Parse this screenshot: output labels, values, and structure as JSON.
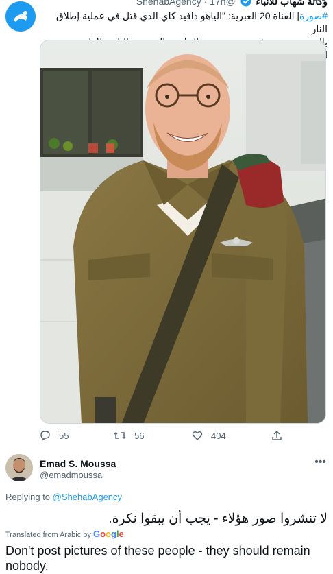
{
  "source_tweet": {
    "display_name": "وكالة شهاب للأنباء",
    "handle": "@ShehabAgency",
    "time": "· 17h",
    "hashtag": "#صورة",
    "text_line1": "| القناة 20 العبرية: \"الياهو دافيد كاي الذي قتل في عملية إطلاق النار",
    "text_line2": "بالقدس، ويخدم في سرية حيتس الخاصة بالحريديم التابعة للواء المظليين\"."
  },
  "actions": {
    "replies": "55",
    "retweets": "56",
    "likes": "404"
  },
  "reply_tweet": {
    "display_name": "Emad S. Moussa",
    "handle": "@emadmoussa",
    "replying_prefix": "Replying to ",
    "replying_to": "@ShehabAgency",
    "text": "لا تنشروا صور هؤلاء - يجب أن يبقوا نكرة.",
    "translated_from": "Translated from Arabic by ",
    "google": [
      "G",
      "o",
      "o",
      "g",
      "l",
      "e"
    ],
    "translation": "Don't post pictures of these people - they should remain nobody."
  },
  "colors": {
    "link": "#1d9bf0",
    "secondary_text": "#536471",
    "uniform": "#7d6a3a"
  },
  "icons": [
    "more-icon",
    "verified-icon",
    "reply-icon",
    "retweet-icon",
    "like-icon",
    "share-icon"
  ]
}
